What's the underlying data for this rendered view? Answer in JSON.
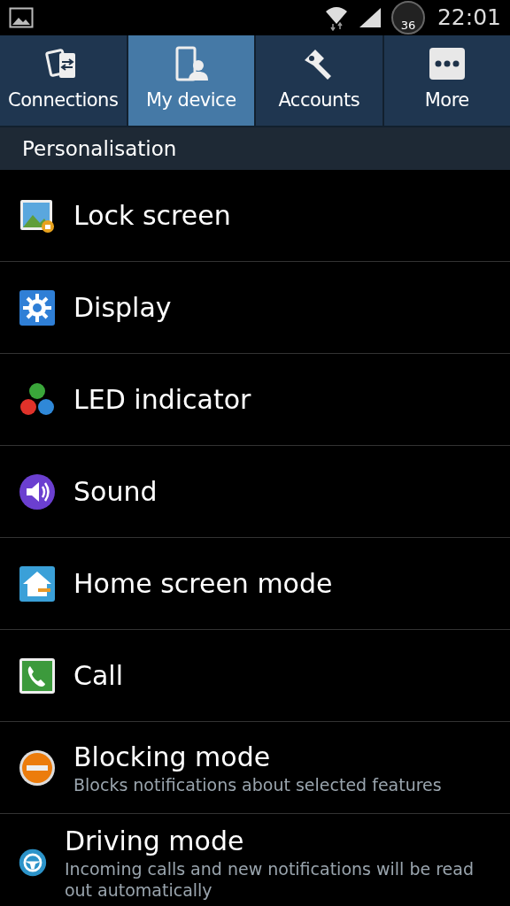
{
  "status_bar": {
    "battery": "36",
    "time": "22:01"
  },
  "tabs": [
    {
      "label": "Connections",
      "selected": false,
      "kind": "connections"
    },
    {
      "label": "My device",
      "selected": true,
      "kind": "device"
    },
    {
      "label": "Accounts",
      "selected": false,
      "kind": "accounts"
    },
    {
      "label": "More",
      "selected": false,
      "kind": "more"
    }
  ],
  "section": "Personalisation",
  "items": [
    {
      "title": "Lock screen",
      "kind": "lock"
    },
    {
      "title": "Display",
      "kind": "display"
    },
    {
      "title": "LED indicator",
      "kind": "led"
    },
    {
      "title": "Sound",
      "kind": "sound"
    },
    {
      "title": "Home screen mode",
      "kind": "home"
    },
    {
      "title": "Call",
      "kind": "call"
    },
    {
      "title": "Blocking mode",
      "subtitle": "Blocks notifications about selected features",
      "kind": "blocking"
    },
    {
      "title": "Driving mode",
      "subtitle": "Incoming calls and new notifications will be read out automatically",
      "kind": "driving"
    }
  ]
}
